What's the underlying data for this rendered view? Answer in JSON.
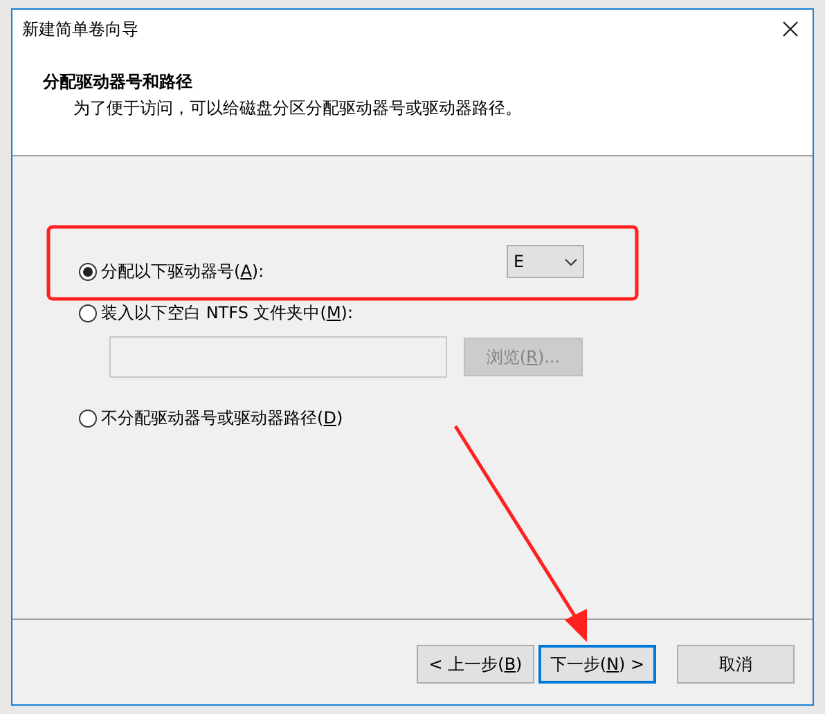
{
  "window": {
    "title": "新建简单卷向导"
  },
  "header": {
    "title": "分配驱动器号和路径",
    "subtitle": "为了便于访问，可以给磁盘分区分配驱动器号或驱动器路径。"
  },
  "options": [
    {
      "kind": "drive_letter",
      "label_before": "分配以下驱动器号(",
      "access_key": "A",
      "label_after": "):",
      "selected": true,
      "value": "E"
    },
    {
      "kind": "folder",
      "label_before": "装入以下空白 NTFS 文件夹中(",
      "access_key": "M",
      "label_after": "):",
      "selected": false,
      "browse": {
        "label_before": "浏览(",
        "access_key": "R",
        "label_after": ")...",
        "disabled": true
      }
    },
    {
      "kind": "none",
      "label_before": "不分配驱动器号或驱动器路径(",
      "access_key": "D",
      "label_after": ")",
      "selected": false
    }
  ],
  "buttons": [
    {
      "label_before": "< 上一步(",
      "access_key": "B",
      "label_after": ")",
      "default": false
    },
    {
      "label_before": "下一步(",
      "access_key": "N",
      "label_after": ") >",
      "default": true
    },
    {
      "label_before": "取消",
      "default": false
    }
  ]
}
